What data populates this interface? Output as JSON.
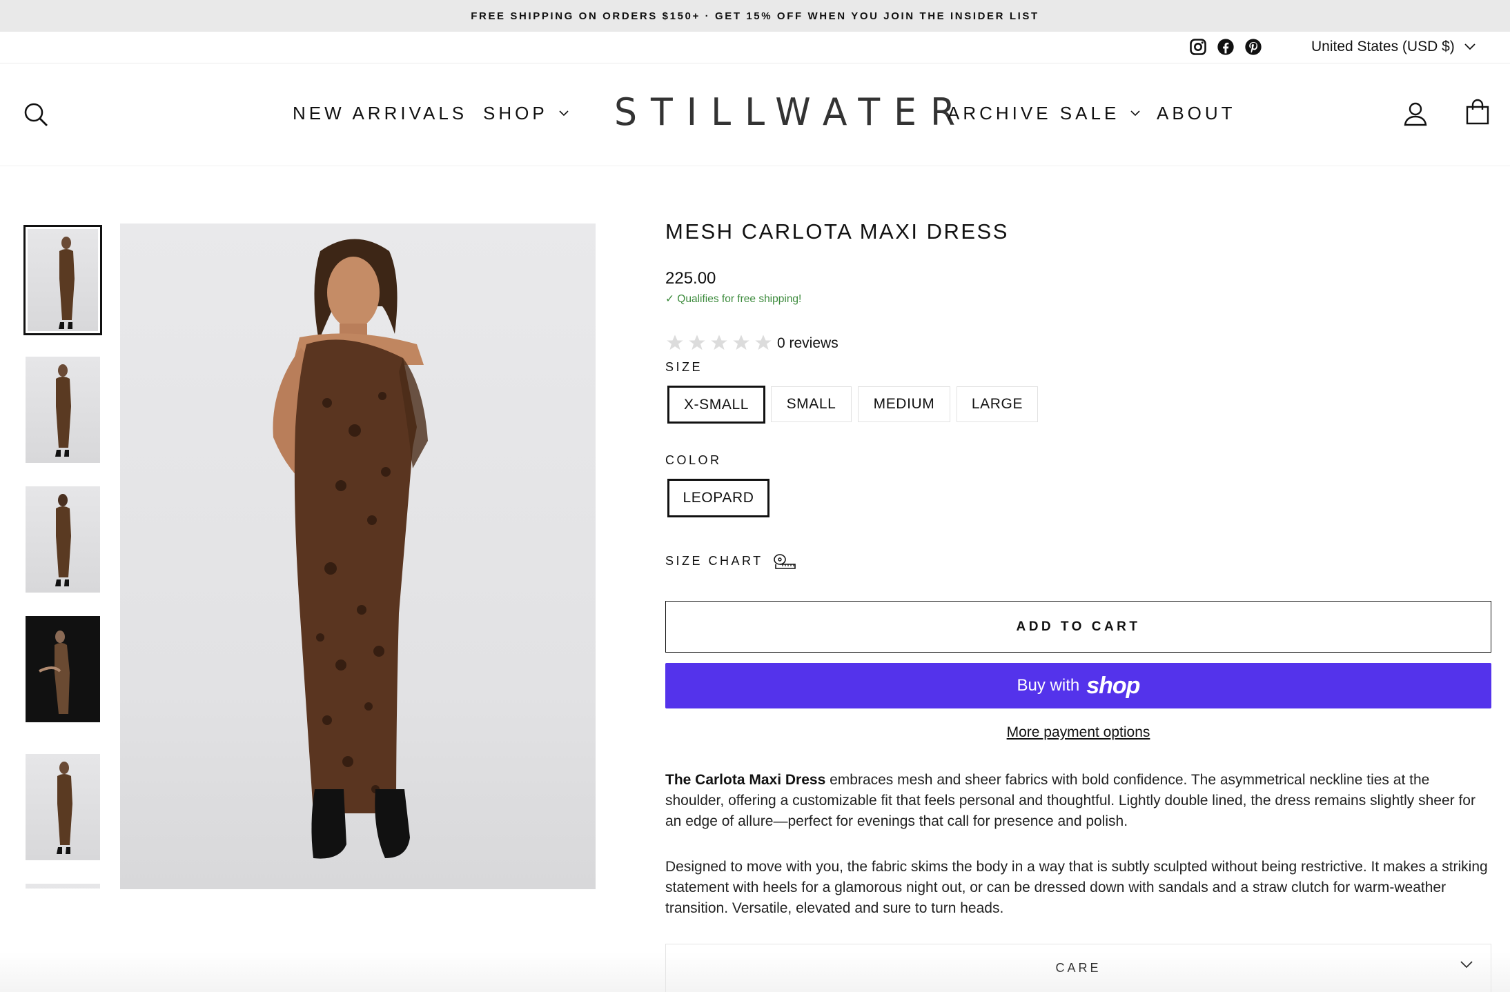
{
  "announcement": "FREE SHIPPING ON ORDERS $150+ · GET 15% OFF WHEN YOU JOIN THE INSIDER LIST",
  "utility": {
    "social_icons": [
      "instagram-icon",
      "facebook-icon",
      "pinterest-icon"
    ],
    "currency": "United States (USD $)"
  },
  "header": {
    "logo": "STILLWATER",
    "nav_left": [
      "NEW ARRIVALS",
      "SHOP"
    ],
    "nav_right": [
      "ARCHIVE SALE",
      "ABOUT"
    ],
    "icons": [
      "search-icon",
      "account-icon",
      "cart-icon"
    ]
  },
  "gallery": {
    "thumbnail_count": 6,
    "active_index": 0
  },
  "product": {
    "title": "MESH CARLOTA MAXI DRESS",
    "price": "225.00",
    "shipping_note": "✓ Qualifies for free shipping!",
    "rating": 0,
    "reviews_label": "0 reviews",
    "size_label": "SIZE",
    "sizes": [
      "X-SMALL",
      "SMALL",
      "MEDIUM",
      "LARGE"
    ],
    "selected_size": "X-SMALL",
    "color_label": "COLOR",
    "colors": [
      "LEOPARD"
    ],
    "selected_color": "LEOPARD",
    "size_chart_label": "SIZE CHART",
    "add_to_cart": "ADD TO CART",
    "buy_with": "Buy with",
    "shop_word": "shop",
    "more_payment": "More payment options",
    "description_bold": "The Carlota Maxi Dress",
    "description_1": " embraces mesh and sheer fabrics with bold confidence. The asymmetrical neckline ties at the shoulder, offering a customizable fit that feels personal and thoughtful. Lightly double lined, the dress remains slightly sheer for an edge of allure—perfect for evenings that call for presence and polish.",
    "description_2": "Designed to move with you, the fabric skims the body in a way that is subtly sculpted without being restrictive. It makes a striking statement with heels for a glamorous night out, or can be dressed down with sandals and a straw clutch for warm-weather transition. Versatile, elevated and sure to turn heads.",
    "care_label": "CARE"
  },
  "colors": {
    "shop_pay": "#5433eb",
    "shipping_green": "#3b8a3b",
    "announcement_bg": "#e9e9e9"
  }
}
